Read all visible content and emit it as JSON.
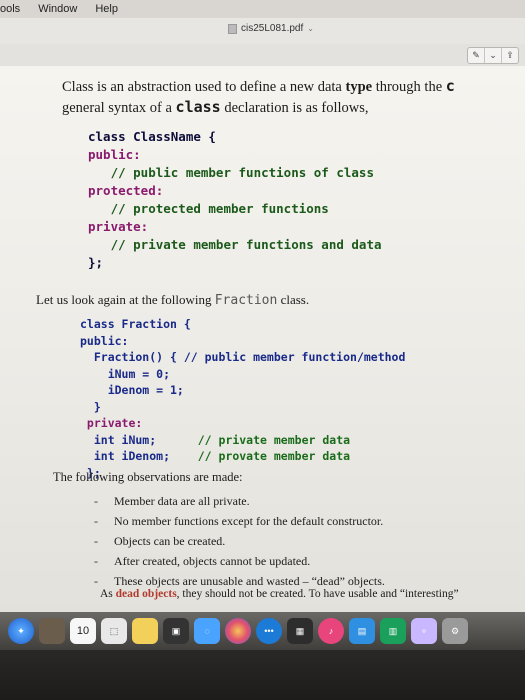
{
  "menubar": {
    "items": [
      "ools",
      "Window",
      "Help"
    ]
  },
  "window": {
    "title": "cis25L081.pdf"
  },
  "toolbar": {
    "buttons": [
      "pen-icon",
      "chevron-down-icon",
      "share-icon"
    ]
  },
  "page": {
    "intro_pre": "Class is an abstraction used to define a new data ",
    "intro_bold": "type",
    "intro_post": " through the ",
    "intro_cut": "c",
    "intro_line2_pre": "general syntax of a ",
    "intro_line2_kw": "class",
    "intro_line2_post": " declaration is as follows,",
    "code1": [
      "class ClassName {",
      "public:",
      "   // public member functions of class",
      "protected:",
      "   // protected member functions",
      "private:",
      "   // private member functions and data",
      "};"
    ],
    "p2_pre": "Let us look again at the following ",
    "p2_code": "Fraction",
    "p2_post": " class.",
    "code2": {
      "l1": "class Fraction {",
      "l2": "public:",
      "l3": "  Fraction() { // public member function/method",
      "l4": "    iNum = 0;",
      "l5": "    iDenom = 1;",
      "l6": "  }",
      "l7": " private:",
      "l8a": "  int iNum;",
      "l8b": "// private member data",
      "l9a": "  int iDenom;",
      "l9b": "// provate member data",
      "l10": " };"
    },
    "observations_heading": "The following observations are made:",
    "bullets": [
      "Member data are all private.",
      "No member functions except for the default constructor.",
      "Objects can be created.",
      "After created, objects cannot be updated.",
      "These objects are unusable and wasted – “dead” objects."
    ],
    "last_line_pre": "As ",
    "last_line_red": "dead objects",
    "last_line_post": ", they should not be created. To have usable and “interesting”"
  },
  "dock": {
    "icons": [
      "safari-icon",
      "app-icon",
      "calendar-icon",
      "preview-icon",
      "notes-icon",
      "photos-icon",
      "messages-icon",
      "facetime-icon",
      "photo-booth-icon",
      "itunes-icon",
      "ibooks-icon",
      "app-store-icon",
      "numbers-icon",
      "keynote-icon",
      "system-preferences-icon"
    ],
    "calendar_day": "10"
  },
  "colors": {
    "page_bg": "#f6f4ef",
    "code_blue": "#1a2a8a",
    "comment_green": "#1a6b1a",
    "keyword_magenta": "#8a1a6e",
    "red": "#b23a2e"
  }
}
